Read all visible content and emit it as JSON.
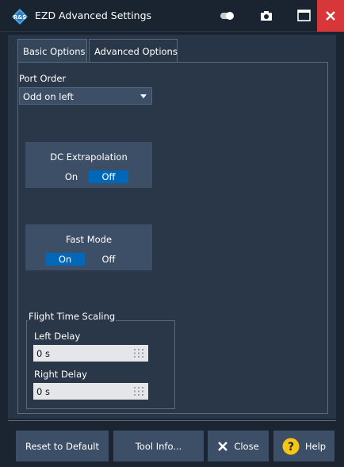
{
  "window": {
    "title": "EZD Advanced Settings",
    "icons": {
      "logo": "rs-logo-icon",
      "toggle": "toggle-icon",
      "camera": "camera-icon",
      "maximize": "maximize-icon",
      "close": "close-icon"
    },
    "close_color": "#d8373a"
  },
  "tabs": [
    {
      "label": "Basic Options",
      "selected": true
    },
    {
      "label": "Advanced Options",
      "selected": false
    }
  ],
  "port_order": {
    "label": "Port Order",
    "value": "Odd on left"
  },
  "dc_extrapolation": {
    "title": "DC Extrapolation",
    "on_label": "On",
    "off_label": "Off",
    "selected": "Off"
  },
  "fast_mode": {
    "title": "Fast Mode",
    "on_label": "On",
    "off_label": "Off",
    "selected": "On"
  },
  "flight_time_scaling": {
    "title": "Flight Time Scaling",
    "left_delay": {
      "label": "Left Delay",
      "value": "0 s"
    },
    "right_delay": {
      "label": "Right Delay",
      "value": "0 s"
    }
  },
  "buttons": {
    "reset": "Reset to Default",
    "tool_info": "Tool Info...",
    "close": "Close",
    "help": "Help"
  },
  "colors": {
    "accent": "#0067b9",
    "help_icon": "#f5c518",
    "background": "#1b2431"
  }
}
